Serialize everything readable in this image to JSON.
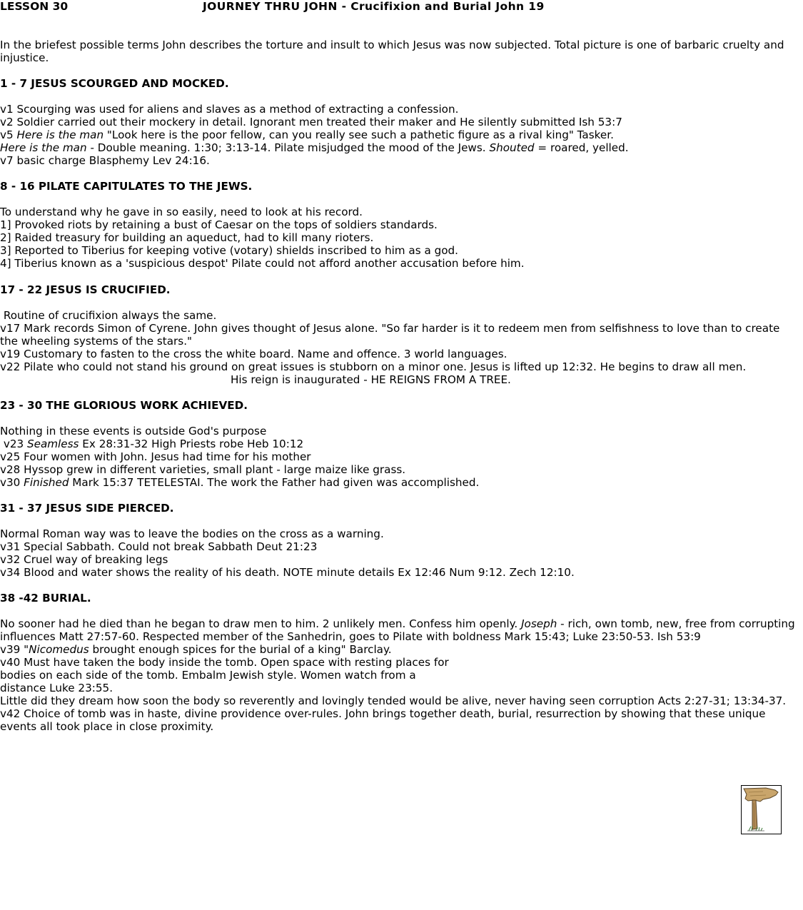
{
  "header": {
    "lesson": "LESSON 30",
    "title": "JOURNEY THRU JOHN - Crucifixion and Burial John 19"
  },
  "intro": "In the briefest possible terms John describes the torture and insult to which Jesus was now subjected. Total picture is one of barbaric cruelty and injustice.",
  "sections": {
    "s1": {
      "heading": "1 - 7 JESUS SCOURGED AND MOCKED.",
      "l1": "v1 Scourging was used for aliens and slaves as a method of extracting a confession.",
      "l2": "v2 Soldier carried out their mockery in detail. Ignorant men treated their maker and He silently submitted Ish 53:7",
      "l3_pre": "v5 ",
      "l3_em": "Here is the man",
      "l3_post": " \"Look here is the poor fellow, can you really see such a pathetic figure as a rival king\" Tasker.",
      "l4_em1": "Here is the man",
      "l4_mid": " - Double meaning. 1:30; 3:13-14. Pilate misjudged the mood of the Jews. ",
      "l4_em2": "Shouted",
      "l4_post": " = roared, yelled.",
      "l5": "v7 basic charge Blasphemy Lev 24:16."
    },
    "s2": {
      "heading": "8 - 16 PILATE CAPITULATES TO THE JEWS.",
      "l1": "To understand why he gave in so easily, need to look at his record.",
      "l2": "1] Provoked riots by retaining a bust of Caesar on the tops of soldiers standards.",
      "l3": "2] Raided treasury for building an aqueduct, had to kill many rioters.",
      "l4": "3] Reported to Tiberius for keeping votive (votary) shields inscribed to him as a god.",
      "l5": "4] Tiberius known as a 'suspicious despot' Pilate could not afford another accusation before him."
    },
    "s3": {
      "heading": "17 - 22 JESUS IS CRUCIFIED.",
      "l1": " Routine of crucifixion always the same.",
      "l2": "v17 Mark records Simon of Cyrene. John gives thought of Jesus alone. \"So far harder is it to redeem men from selfishness to love than to create the wheeling systems of the stars.\"",
      "l3": "v19 Customary to fasten to the cross the white board. Name and offence. 3 world languages.",
      "l4": "v22 Pilate who could not stand his ground on great issues is stubborn on a minor one. Jesus is lifted up 12:32. He begins to draw all men.",
      "center": "His reign is inaugurated - HE REIGNS FROM A TREE."
    },
    "s4": {
      "heading": "23 - 30 THE GLORIOUS WORK ACHIEVED.",
      "l1": "Nothing in these events is outside God's purpose",
      "l2_pre": " v23 ",
      "l2_em": "Seamless",
      "l2_post": " Ex 28:31-32 High Priests robe Heb 10:12",
      "l3": "v25 Four women with John. Jesus had time for his mother",
      "l4": "v28 Hyssop grew in different varieties, small plant - large maize like grass.",
      "l5_pre": "v30 ",
      "l5_em": "Finished",
      "l5_post": " Mark 15:37 TETELESTAI. The work the Father had given was accomplished."
    },
    "s5": {
      "heading": "31 - 37 JESUS SIDE PIERCED.",
      "l1": "Normal Roman way was to leave the bodies on the cross as a warning.",
      "l2": "v31 Special Sabbath. Could not break Sabbath Deut 21:23",
      "l3": "v32 Cruel way of breaking legs",
      "l4": "v34 Blood and water shows the reality of his death. NOTE minute details Ex 12:46 Num 9:12. Zech 12:10."
    },
    "s6": {
      "heading": "38 -42 BURIAL.",
      "l1_pre": "No sooner had he died than he began to draw men to him. 2 unlikely men. Confess him openly. ",
      "l1_em": "Joseph",
      "l1_post": " - rich, own tomb, new, free from corrupting influences Matt 27:57-60. Respected member of the Sanhedrin, goes to Pilate with boldness Mark 15:43; Luke 23:50-53. Ish 53:9",
      "l2_pre": "v39 ",
      "l2_em": "\"Nicomedus",
      "l2_post": " brought enough spices for the burial of a king\" Barclay.",
      "l3a": "v40 Must have taken the body inside the tomb. Open space with resting places for",
      "l3b": "bodies on each side of the tomb. Embalm Jewish style. Women watch from a",
      "l3c": "distance Luke 23:55.",
      "l4": "Little did they dream how soon the body so reverently and lovingly tended would be alive, never having seen corruption Acts 2:27-31; 13:34-37.",
      "l5": "v42 Choice of tomb was in haste, divine providence over-rules. John brings together death, burial, resurrection by showing that these unique events all took place in close proximity."
    }
  },
  "footer_icon": "signpost-icon"
}
